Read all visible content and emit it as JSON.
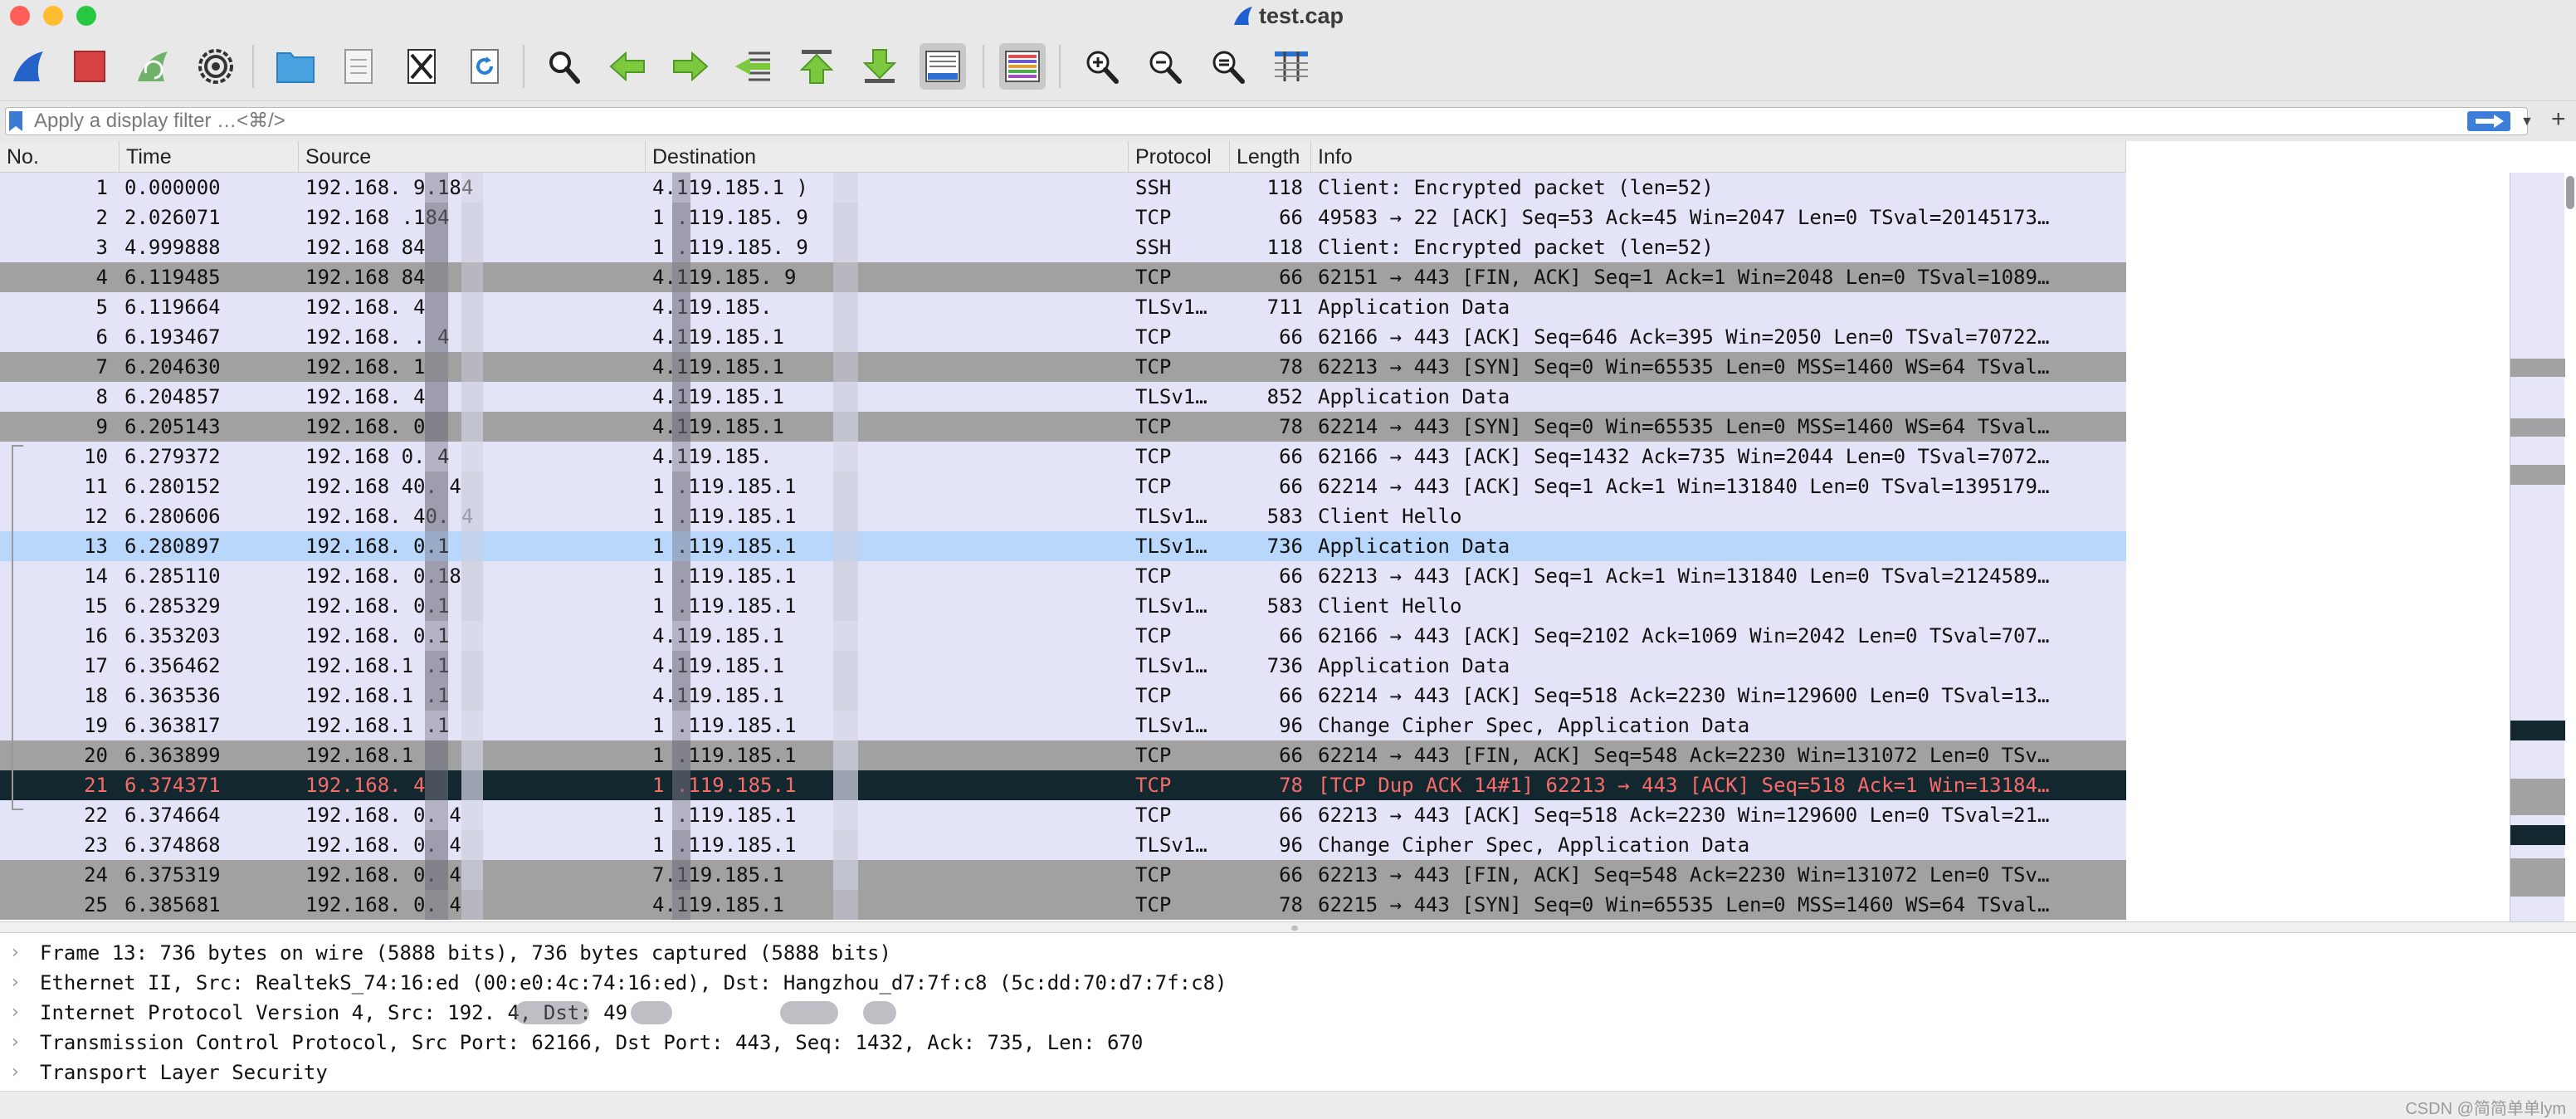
{
  "window": {
    "title": "test.cap",
    "traffic_lights": [
      "#fe5f57",
      "#febc2e",
      "#28c840"
    ]
  },
  "toolbar": {
    "buttons": [
      {
        "name": "start-capture-icon",
        "label": "Start capture"
      },
      {
        "name": "stop-capture-icon",
        "label": "Stop capture"
      },
      {
        "name": "restart-capture-icon",
        "label": "Restart capture"
      },
      {
        "name": "capture-options-icon",
        "label": "Capture options"
      },
      {
        "name": "open-file-icon",
        "label": "Open"
      },
      {
        "name": "save-file-icon",
        "label": "Save"
      },
      {
        "name": "close-file-icon",
        "label": "Close"
      },
      {
        "name": "reload-file-icon",
        "label": "Reload"
      },
      {
        "name": "find-packet-icon",
        "label": "Find packet"
      },
      {
        "name": "go-back-icon",
        "label": "Back"
      },
      {
        "name": "go-forward-icon",
        "label": "Forward"
      },
      {
        "name": "go-to-packet-icon",
        "label": "Go to packet"
      },
      {
        "name": "first-packet-icon",
        "label": "First packet"
      },
      {
        "name": "last-packet-icon",
        "label": "Last packet"
      },
      {
        "name": "auto-scroll-icon",
        "label": "Auto scroll"
      },
      {
        "name": "colorize-icon",
        "label": "Colorize"
      },
      {
        "name": "zoom-in-icon",
        "label": "Zoom in"
      },
      {
        "name": "zoom-out-icon",
        "label": "Zoom out"
      },
      {
        "name": "normal-size-icon",
        "label": "Normal size"
      },
      {
        "name": "resize-columns-icon",
        "label": "Resize columns"
      }
    ]
  },
  "filter": {
    "placeholder": "Apply a display filter …<⌘/>"
  },
  "columns": {
    "no": "No.",
    "time": "Time",
    "source": "Source",
    "destination": "Destination",
    "protocol": "Protocol",
    "length": "Length",
    "info": "Info"
  },
  "colors": {
    "row_lavender": "#e4e4f8",
    "row_gray": "#a1a1a1",
    "row_selected": "#b9d7fb",
    "row_dark": "#12272e",
    "row_dark_text": "#f76b6b"
  },
  "packets": [
    {
      "no": "1",
      "time": "0.000000",
      "src": "192.168.   9.184",
      "dst": "  4.119.185.1  )",
      "proto": "SSH",
      "len": "118",
      "info": "Client: Encrypted packet (len=52)",
      "style": "lavender"
    },
    {
      "no": "2",
      "time": "2.026071",
      "src": "192.168     .184",
      "dst": "1  .119.185.  9",
      "proto": "TCP",
      "len": "66",
      "info": "49583 → 22 [ACK] Seq=53 Ack=45 Win=2047 Len=0 TSval=20145173…",
      "style": "lavender"
    },
    {
      "no": "3",
      "time": "4.999888",
      "src": "192.168      84",
      "dst": "1  .119.185.  9",
      "proto": "SSH",
      "len": "118",
      "info": "Client: Encrypted packet (len=52)",
      "style": "lavender"
    },
    {
      "no": "4",
      "time": "6.119485",
      "src": "192.168      84",
      "dst": "  4.119.185.  9",
      "proto": "TCP",
      "len": "66",
      "info": "62151 → 443 [FIN, ACK] Seq=1 Ack=1 Win=2048 Len=0 TSval=1089…",
      "style": "gray"
    },
    {
      "no": "5",
      "time": "6.119664",
      "src": "192.168.     4",
      "dst": "  4.119.185.  ",
      "proto": "TLSv1…",
      "len": "711",
      "info": "Application Data",
      "style": "lavender"
    },
    {
      "no": "6",
      "time": "6.193467",
      "src": "192.168.   .  4",
      "dst": "  4.119.185.1",
      "proto": "TCP",
      "len": "66",
      "info": "62166 → 443 [ACK] Seq=646 Ack=395 Win=2050 Len=0 TSval=70722…",
      "style": "lavender"
    },
    {
      "no": "7",
      "time": "6.204630",
      "src": "192.168.     1",
      "dst": "  4.119.185.1",
      "proto": "TCP",
      "len": "78",
      "info": "62213 → 443 [SYN] Seq=0 Win=65535 Len=0 MSS=1460 WS=64 TSval…",
      "style": "gray"
    },
    {
      "no": "8",
      "time": "6.204857",
      "src": "192.168.      4",
      "dst": "  4.119.185.1",
      "proto": "TLSv1…",
      "len": "852",
      "info": "Application Data",
      "style": "lavender"
    },
    {
      "no": "9",
      "time": "6.205143",
      "src": "192.168.   0   ",
      "dst": "  4.119.185.1",
      "proto": "TCP",
      "len": "78",
      "info": "62214 → 443 [SYN] Seq=0 Win=65535 Len=0 MSS=1460 WS=64 TSval…",
      "style": "gray"
    },
    {
      "no": "10",
      "time": "6.279372",
      "src": "192.168    0.  4",
      "dst": "  4.119.185.  ",
      "proto": "TCP",
      "len": "66",
      "info": "62166 → 443 [ACK] Seq=1432 Ack=735 Win=2044 Len=0 TSval=7072…",
      "style": "lavender"
    },
    {
      "no": "11",
      "time": "6.280152",
      "src": "192.168   40.  4",
      "dst": "1  .119.185.1",
      "proto": "TCP",
      "len": "66",
      "info": "62214 → 443 [ACK] Seq=1 Ack=1 Win=131840 Len=0 TSval=1395179…",
      "style": "lavender"
    },
    {
      "no": "12",
      "time": "6.280606",
      "src": "192.168.  40.  4",
      "dst": "1  .119.185.1",
      "proto": "TLSv1…",
      "len": "583",
      "info": "Client Hello",
      "style": "lavender"
    },
    {
      "no": "13",
      "time": "6.280897",
      "src": "192.168.   0.1",
      "dst": "1  .119.185.1",
      "proto": "TLSv1…",
      "len": "736",
      "info": "Application Data",
      "style": "selected"
    },
    {
      "no": "14",
      "time": "6.285110",
      "src": "192.168.   0.18",
      "dst": "1  .119.185.1",
      "proto": "TCP",
      "len": "66",
      "info": "62213 → 443 [ACK] Seq=1 Ack=1 Win=131840 Len=0 TSval=2124589…",
      "style": "lavender"
    },
    {
      "no": "15",
      "time": "6.285329",
      "src": "192.168.   0.1",
      "dst": "1  .119.185.1",
      "proto": "TLSv1…",
      "len": "583",
      "info": "Client Hello",
      "style": "lavender"
    },
    {
      "no": "16",
      "time": "6.353203",
      "src": "192.168.   0.1",
      "dst": "  4.119.185.1",
      "proto": "TCP",
      "len": "66",
      "info": "62166 → 443 [ACK] Seq=2102 Ack=1069 Win=2042 Len=0 TSval=707…",
      "style": "lavender"
    },
    {
      "no": "17",
      "time": "6.356462",
      "src": "192.168.1   .1",
      "dst": "  4.119.185.1",
      "proto": "TLSv1…",
      "len": "736",
      "info": "Application Data",
      "style": "lavender"
    },
    {
      "no": "18",
      "time": "6.363536",
      "src": "192.168.1   .1",
      "dst": "  4.119.185.1",
      "proto": "TCP",
      "len": "66",
      "info": "62214 → 443 [ACK] Seq=518 Ack=2230 Win=129600 Len=0 TSval=13…",
      "style": "lavender"
    },
    {
      "no": "19",
      "time": "6.363817",
      "src": "192.168.1   .1",
      "dst": "1  .119.185.1",
      "proto": "TLSv1…",
      "len": "96",
      "info": "Change Cipher Spec, Application Data",
      "style": "lavender"
    },
    {
      "no": "20",
      "time": "6.363899",
      "src": "192.168.1     ",
      "dst": "1  .119.185.1",
      "proto": "TCP",
      "len": "66",
      "info": "62214 → 443 [FIN, ACK] Seq=548 Ack=2230 Win=131072 Len=0 TSv…",
      "style": "gray"
    },
    {
      "no": "21",
      "time": "6.374371",
      "src": "192.168.      4",
      "dst": "1  .119.185.1",
      "proto": "TCP",
      "len": "78",
      "info": "[TCP Dup ACK 14#1] 62213 → 443 [ACK] Seq=518 Ack=1 Win=13184…",
      "style": "dark"
    },
    {
      "no": "22",
      "time": "6.374664",
      "src": "192.168.   0.  4",
      "dst": "1  .119.185.1",
      "proto": "TCP",
      "len": "66",
      "info": "62213 → 443 [ACK] Seq=518 Ack=2230 Win=129600 Len=0 TSval=21…",
      "style": "lavender"
    },
    {
      "no": "23",
      "time": "6.374868",
      "src": "192.168.   0.  4",
      "dst": "1  .119.185.1",
      "proto": "TLSv1…",
      "len": "96",
      "info": "Change Cipher Spec, Application Data",
      "style": "lavender"
    },
    {
      "no": "24",
      "time": "6.375319",
      "src": "192.168.   0.  4",
      "dst": "  7.119.185.1",
      "proto": "TCP",
      "len": "66",
      "info": "62213 → 443 [FIN, ACK] Seq=548 Ack=2230 Win=131072 Len=0 TSv…",
      "style": "gray"
    },
    {
      "no": "25",
      "time": "6.385681",
      "src": "192.168.   0.  4",
      "dst": "  4.119.185.1",
      "proto": "TCP",
      "len": "78",
      "info": "62215 → 443 [SYN] Seq=0 Win=65535 Len=0 MSS=1460 WS=64 TSval…",
      "style": "gray"
    }
  ],
  "details": [
    "Frame 13: 736 bytes on wire (5888 bits), 736 bytes captured (5888 bits)",
    "Ethernet II, Src: RealtekS_74:16:ed (00:e0:4c:74:16:ed), Dst: Hangzhou_d7:7f:c8 (5c:dd:70:d7:7f:c8)",
    "Internet Protocol Version 4, Src: 192.        4, Dst:             49",
    "Transmission Control Protocol, Src Port: 62166, Dst Port: 443, Seq: 1432, Ack: 735, Len: 670",
    "Transport Layer Security"
  ],
  "watermark": "CSDN @简简单单lym"
}
